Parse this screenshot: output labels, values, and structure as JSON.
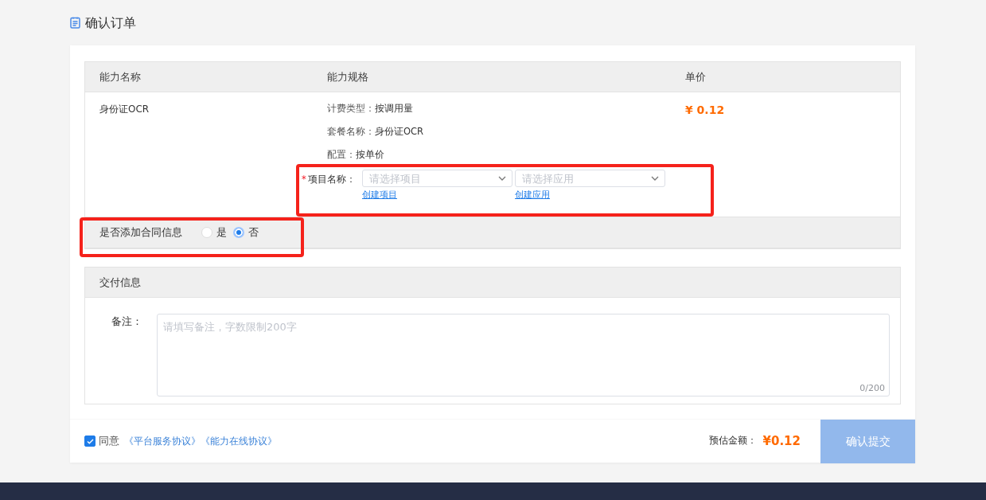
{
  "page_title": "确认订单",
  "table": {
    "columns": [
      "能力名称",
      "能力规格",
      "单价"
    ],
    "row": {
      "name": "身份证OCR",
      "specs": [
        {
          "label": "计费类型：",
          "value": "按调用量"
        },
        {
          "label": "套餐名称：",
          "value": "身份证OCR"
        },
        {
          "label": "配置：",
          "value": "按单价"
        }
      ],
      "project": {
        "required_mark": "*",
        "label": "项目名称：",
        "selects": [
          {
            "placeholder": "请选择项目",
            "link": "创建项目"
          },
          {
            "placeholder": "请选择应用",
            "link": "创建应用"
          }
        ]
      },
      "price": "¥ 0.12"
    }
  },
  "contract": {
    "label": "是否添加合同信息",
    "options": [
      {
        "label": "是",
        "selected": false
      },
      {
        "label": "否",
        "selected": true
      }
    ]
  },
  "delivery": {
    "title": "交付信息",
    "remark_label": "备注：",
    "placeholder": "请填写备注，字数限制200字",
    "counter": "0/200"
  },
  "footer": {
    "agree": {
      "checked": true,
      "label": "同意"
    },
    "links": [
      "《平台服务协议》",
      "《能力在线协议》"
    ],
    "estimate_label": "预估金额：",
    "estimate": "¥0.12",
    "submit": "确认提交"
  }
}
